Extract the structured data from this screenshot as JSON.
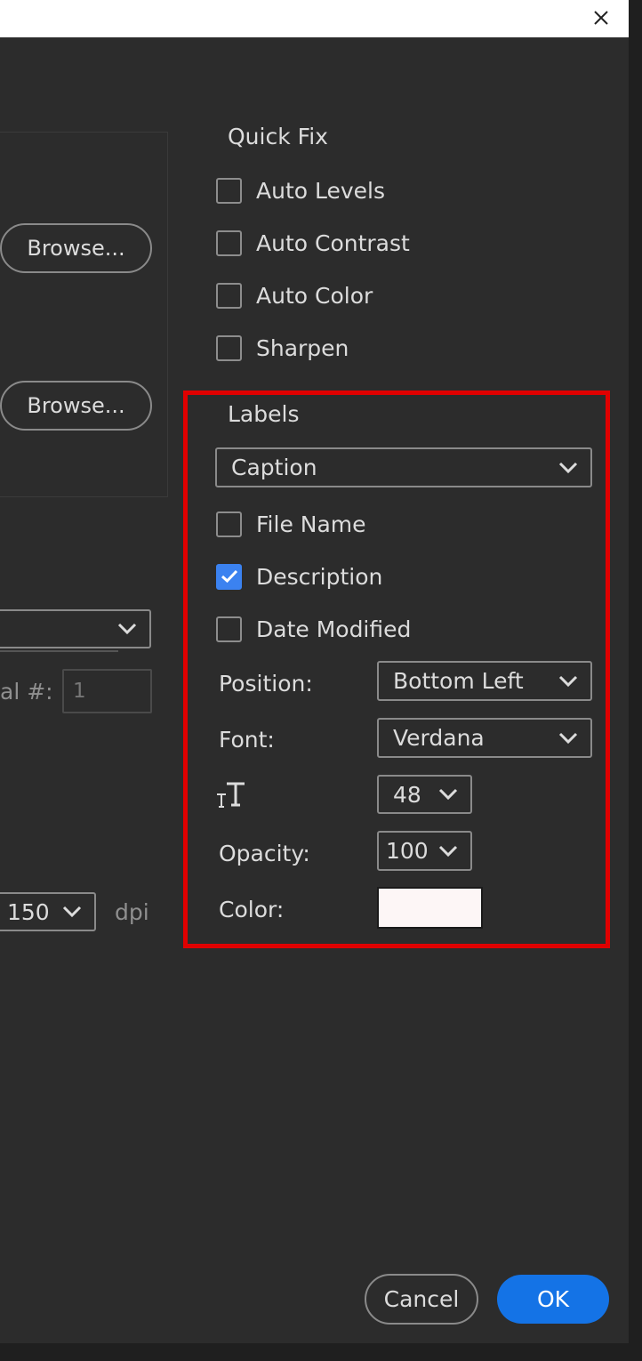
{
  "window": {
    "close_icon": "close-icon"
  },
  "source": {
    "browse_label_1": "Browse...",
    "browse_label_2": "Browse..."
  },
  "left_fields": {
    "serial_label": "al #:",
    "serial_value": "1",
    "resolution_value": "150",
    "resolution_unit": "dpi"
  },
  "quick_fix": {
    "title": "Quick Fix",
    "items": [
      {
        "label": "Auto Levels",
        "checked": false
      },
      {
        "label": "Auto Contrast",
        "checked": false
      },
      {
        "label": "Auto Color",
        "checked": false
      },
      {
        "label": "Sharpen",
        "checked": false
      }
    ]
  },
  "labels": {
    "title": "Labels",
    "type_value": "Caption",
    "items": [
      {
        "label": "File Name",
        "checked": false
      },
      {
        "label": "Description",
        "checked": true
      },
      {
        "label": "Date Modified",
        "checked": false
      }
    ],
    "position_label": "Position:",
    "position_value": "Bottom Left",
    "font_label": "Font:",
    "font_value": "Verdana",
    "size_icon": "font-size-icon",
    "size_value": "48",
    "opacity_label": "Opacity:",
    "opacity_value": "100",
    "color_label": "Color:",
    "color_value": "#fdf6f6"
  },
  "footer": {
    "cancel_label": "Cancel",
    "ok_label": "OK"
  },
  "colors": {
    "highlight": "#e00000",
    "accent": "#1473e6",
    "checkbox_checked": "#3b82f0"
  }
}
